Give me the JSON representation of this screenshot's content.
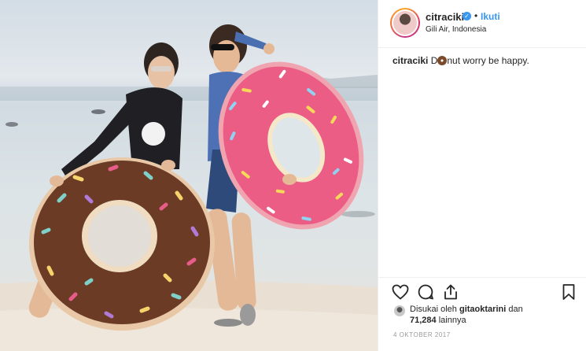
{
  "post": {
    "photo_alt": "Two women holding inflatable donut rings on a beach"
  },
  "header": {
    "username": "citraciki",
    "verified_badge": "✓",
    "separator": "•",
    "follow_label": "Ikuti",
    "location": "Gili Air, Indonesia"
  },
  "caption": {
    "username": "citraciki",
    "text_before": " D",
    "emoji": "donut-emoji",
    "text_after": "nut worry be happy."
  },
  "actions": {
    "like_icon": "heart-icon",
    "comment_icon": "comment-icon",
    "share_icon": "share-icon",
    "save_icon": "bookmark-icon"
  },
  "likes": {
    "prefix": "Disukai oleh ",
    "liker": "gitaoktarini",
    "conjunction": " dan",
    "count": "71,284",
    "suffix": " lainnya"
  },
  "date": "4 OKTOBER 2017",
  "colors": {
    "follow_blue": "#3897f0",
    "text": "#262626",
    "muted": "#999999",
    "border": "#efefef"
  }
}
